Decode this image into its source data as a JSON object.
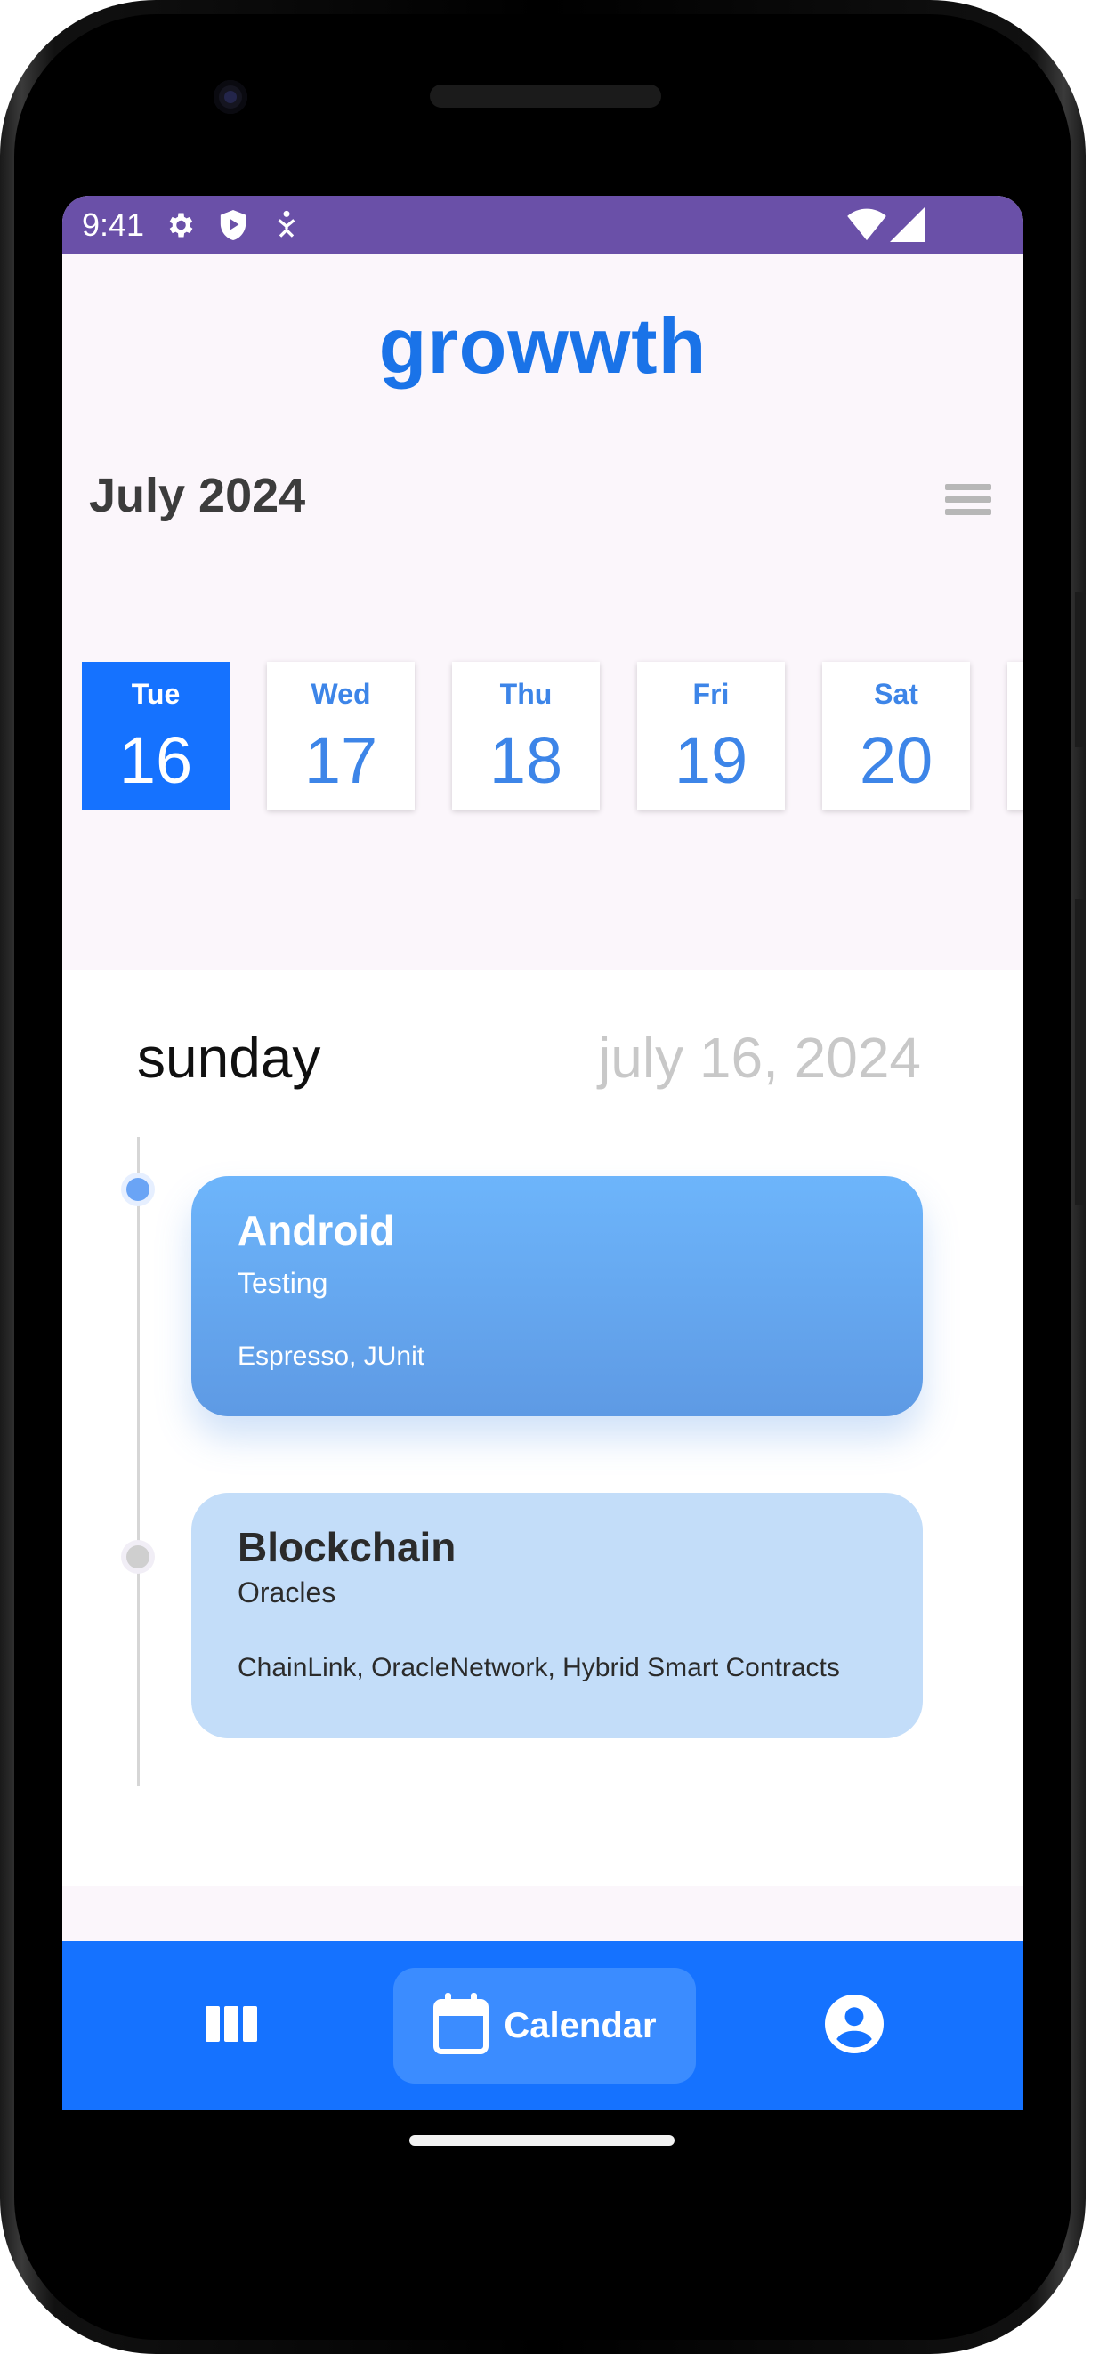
{
  "status_bar": {
    "time": "9:41"
  },
  "app": {
    "title": "growwth"
  },
  "calendar": {
    "month_label": "July 2024",
    "days": [
      {
        "day": "Tue",
        "date": "16",
        "selected": true
      },
      {
        "day": "Wed",
        "date": "17",
        "selected": false
      },
      {
        "day": "Thu",
        "date": "18",
        "selected": false
      },
      {
        "day": "Fri",
        "date": "19",
        "selected": false
      },
      {
        "day": "Sat",
        "date": "20",
        "selected": false
      }
    ]
  },
  "timeline": {
    "weekday": "sunday",
    "date": "july 16, 2024",
    "events": [
      {
        "title": "Android",
        "subtitle": "Testing",
        "tags": "Espresso, JUnit"
      },
      {
        "title": "Blockchain",
        "subtitle": "Oracles",
        "tags": "ChainLink, OracleNetwork, Hybrid Smart Contracts"
      }
    ]
  },
  "bottom_nav": {
    "items": [
      {
        "icon": "board-columns-icon",
        "label": ""
      },
      {
        "icon": "calendar-icon",
        "label": "Calendar",
        "active": true
      },
      {
        "icon": "account-circle-icon",
        "label": ""
      }
    ]
  },
  "colors": {
    "primary": "#1572ff",
    "title": "#1a73e8",
    "status_bar": "#6a50a8",
    "event_primary": "#6db5fb",
    "event_secondary": "#c3ddf9"
  }
}
